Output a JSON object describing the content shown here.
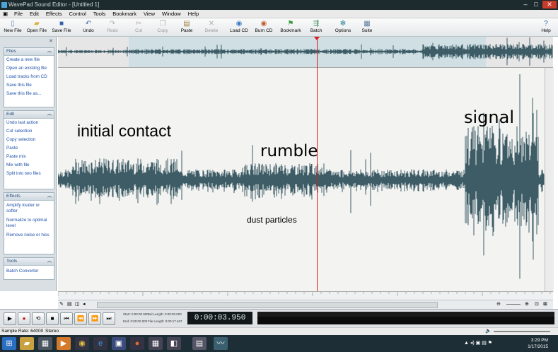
{
  "window": {
    "title": "WavePad Sound Editor - [Untitled 1]"
  },
  "menu": [
    "File",
    "Edit",
    "Effects",
    "Control",
    "Tools",
    "Bookmark",
    "View",
    "Window",
    "Help"
  ],
  "toolbar": {
    "new_file": "New File",
    "open_file": "Open File",
    "save_file": "Save File",
    "undo": "Undo",
    "redo": "Redo",
    "cut": "Cut",
    "copy": "Copy",
    "paste": "Paste",
    "delete": "Delete",
    "load_cd": "Load CD",
    "burn_cd": "Burn CD",
    "bookmark": "Bookmark",
    "batch": "Batch",
    "options": "Options",
    "suite": "Suite",
    "help": "Help"
  },
  "side_panels": [
    {
      "title": "Files",
      "items": [
        "Create a new file",
        "Open an existing file",
        "Load tracks from CD",
        "Save this file",
        "Save this file as..."
      ]
    },
    {
      "title": "Edit",
      "items": [
        "Undo last action",
        "Cut selection",
        "Copy selection",
        "Paste",
        "Paste mix",
        "Mix with file",
        "Split into two files"
      ]
    },
    {
      "title": "Effects",
      "items": [
        "Amplify louder or softer",
        "Normalize to optimal level",
        "Remove noise or hiss"
      ]
    },
    {
      "title": "Tools",
      "items": [
        "Batch Converter"
      ]
    }
  ],
  "annotations": {
    "initial_contact": "initial contact",
    "rumble": "rumble",
    "signal": "signal",
    "dust": "dust particles"
  },
  "transport": {
    "time": "0:00:03.950",
    "start_label": "Start: 0:00:00.000",
    "end_label": "End: 0:00:00.000",
    "sel_length": "Sel Length: 0:00:00.000",
    "file_length": "File Length: 0:00:17.467"
  },
  "status": {
    "sample_rate": "Sample Rate: 64000",
    "channels": "Stereo"
  },
  "clock": {
    "time": "3:29 PM",
    "date": "1/17/2015"
  },
  "colors": {
    "waveform": "#3d5c66",
    "cursor": "#e01818",
    "selection": "#cfdfe4"
  }
}
